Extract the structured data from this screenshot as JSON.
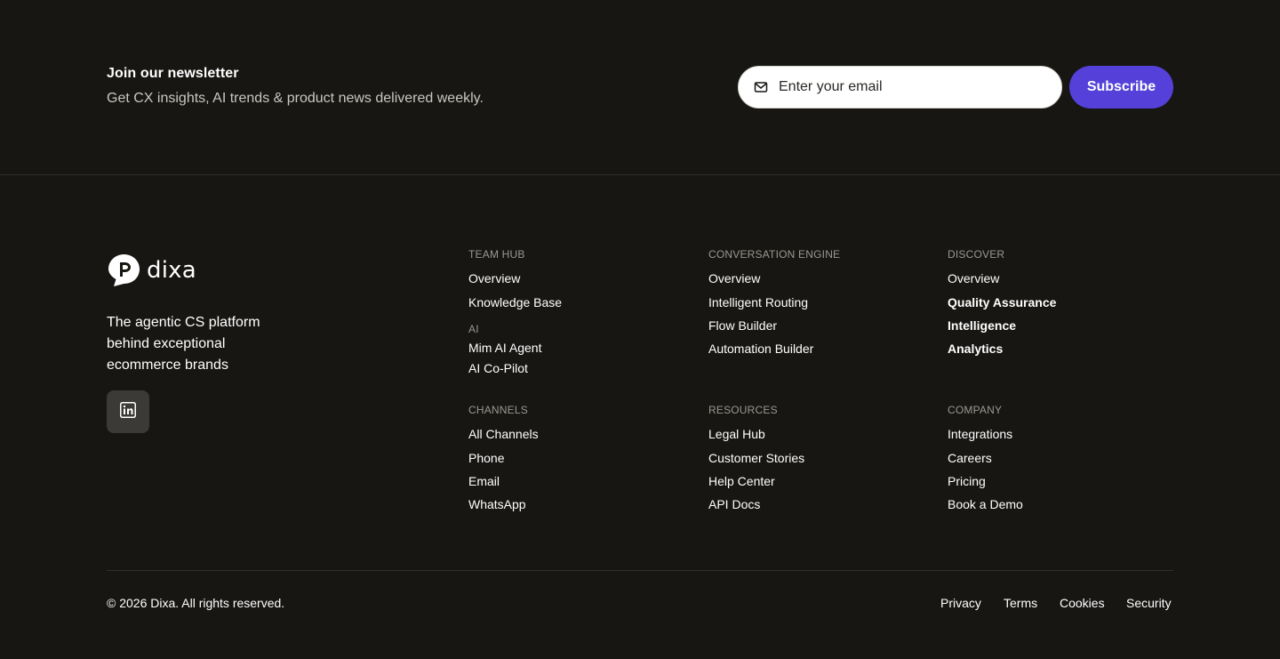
{
  "newsletter": {
    "title": "Join our newsletter",
    "subtitle": "Get CX insights, AI trends & product news delivered weekly.",
    "email_placeholder": "Enter your email",
    "email_icon": "mail-icon",
    "subscribe_label": "Subscribe",
    "accent_color": "#5541d9"
  },
  "brand": {
    "logo_text": "dixa",
    "tagline": "The agentic CS platform behind exceptional ecommerce brands",
    "social_icon": "linkedin-icon"
  },
  "columns": {
    "team_hub": {
      "heading": "TEAM HUB",
      "links": [
        "Overview",
        "Knowledge Base"
      ]
    },
    "ai": {
      "heading": "AI",
      "links": [
        "Mim AI Agent",
        "AI Co-Pilot"
      ]
    },
    "conversation_engine": {
      "heading": "CONVERSATION ENGINE",
      "links": [
        "Overview",
        "Intelligent Routing",
        "Flow Builder",
        "Automation Builder"
      ]
    },
    "discover": {
      "heading": "DISCOVER",
      "links": [
        "Overview",
        "Quality Assurance",
        "Intelligence",
        "Analytics"
      ]
    },
    "channels": {
      "heading": "CHANNELS",
      "links": [
        "All Channels",
        "Phone",
        "Email",
        "WhatsApp"
      ]
    },
    "resources": {
      "heading": "RESOURCES",
      "links": [
        "Legal Hub",
        "Customer Stories",
        "Help Center",
        "API Docs"
      ]
    },
    "company": {
      "heading": "COMPANY",
      "links": [
        "Integrations",
        "Careers",
        "Pricing",
        "Book a Demo"
      ]
    }
  },
  "footer": {
    "copyright": "© 2026 Dixa. All rights reserved.",
    "legal_links": [
      "Privacy",
      "Terms",
      "Cookies",
      "Security"
    ]
  }
}
